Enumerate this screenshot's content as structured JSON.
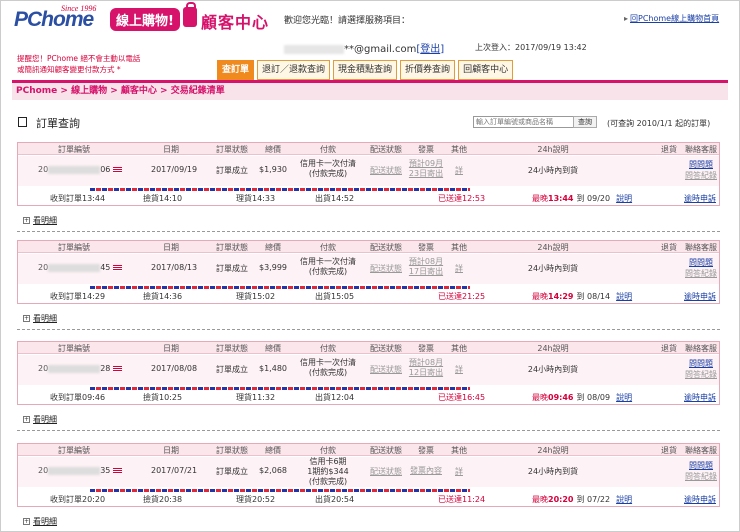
{
  "header": {
    "logo_text": "PChome",
    "logo_since": "Since 1996",
    "logo_shop": "線上購物!",
    "section_title": "顧客中心",
    "welcome": "歡迎您光臨！請選擇服務項目：",
    "back_link": "回PChome線上購物首頁",
    "email_suffix": "**@gmail.com",
    "logout_open": "[",
    "logout": "登出",
    "logout_close": "]",
    "last_login": "上次登入：2017/09/19 13:42",
    "notice_line1": "提醒您！PChome 絕不會主動以電話",
    "notice_line2": "或簡訊通知顧客變更付款方式 *"
  },
  "tabs": [
    {
      "label": "查訂單",
      "active": true
    },
    {
      "label": "退訂／退款查詢",
      "active": false
    },
    {
      "label": "現金積點查詢",
      "active": false
    },
    {
      "label": "折價券查詢",
      "active": false
    },
    {
      "label": "回顧客中心",
      "active": false
    }
  ],
  "breadcrumb": "PChome > 線上購物 > 顧客中心 > 交易紀錄清單",
  "query": {
    "title": "訂單查詢",
    "input_placeholder": "輸入訂單編號或商品名稱",
    "button": "查詢",
    "note": "(可查詢 2010/1/1 起的訂單)"
  },
  "columns": [
    "訂單編號",
    "日期",
    "訂單狀態",
    "總價",
    "付款",
    "配送狀態",
    "發票",
    "其他",
    "24h說明",
    "退貨",
    "聯絡客服"
  ],
  "detail_label": "看明細",
  "orders": [
    {
      "id_visible_prefix": "20",
      "id_visible_suffix": "06",
      "date": "2017/09/19",
      "status": "訂單成立",
      "total": "$1,930",
      "pay1": "信用卡一次付清",
      "pay2": "(付款完成)",
      "shipping": "配送狀態",
      "invoice1": "預計09月",
      "invoice2": "23日寄出",
      "other": "詳",
      "explain": "24小時內到貨",
      "service1": "問問題",
      "service2": "問答紀錄",
      "received": "收到訂單13:44",
      "picked": "撿貨14:10",
      "sorted": "理貨14:33",
      "shipped": "出貨14:52",
      "delivered": "已送達12:53",
      "latest_prefix": "最晚",
      "latest_time": "13:44",
      "latest_suffix": "到 09/20",
      "latest_link": "說明",
      "complaint": "逾時申訴"
    },
    {
      "id_visible_prefix": "20",
      "id_visible_suffix": "45",
      "date": "2017/08/13",
      "status": "訂單成立",
      "total": "$3,999",
      "pay1": "信用卡一次付清",
      "pay2": "(付款完成)",
      "shipping": "配送狀態",
      "invoice1": "預計08月",
      "invoice2": "17日寄出",
      "other": "詳",
      "explain": "24小時內到貨",
      "service1": "問問題",
      "service2": "問答紀錄",
      "received": "收到訂單14:29",
      "picked": "撿貨14:36",
      "sorted": "理貨15:02",
      "shipped": "出貨15:05",
      "delivered": "已送達21:25",
      "latest_prefix": "最晚",
      "latest_time": "14:29",
      "latest_suffix": "到 08/14",
      "latest_link": "說明",
      "complaint": "逾時申訴"
    },
    {
      "id_visible_prefix": "20",
      "id_visible_suffix": "28",
      "date": "2017/08/08",
      "status": "訂單成立",
      "total": "$1,480",
      "pay1": "信用卡一次付清",
      "pay2": "(付款完成)",
      "shipping": "配送狀態",
      "invoice1": "預計08月",
      "invoice2": "12日寄出",
      "other": "詳",
      "explain": "24小時內到貨",
      "service1": "問問題",
      "service2": "問答紀錄",
      "received": "收到訂單09:46",
      "picked": "撿貨10:25",
      "sorted": "理貨11:32",
      "shipped": "出貨12:04",
      "delivered": "已送達16:45",
      "latest_prefix": "最晚",
      "latest_time": "09:46",
      "latest_suffix": "到 08/09",
      "latest_link": "說明",
      "complaint": "逾時申訴"
    },
    {
      "id_visible_prefix": "20",
      "id_visible_suffix": "35",
      "date": "2017/07/21",
      "status": "訂單成立",
      "total": "$2,068",
      "pay1": "信用卡6期",
      "pay1b": "1期約$344",
      "pay2": "(付款完成)",
      "shipping": "配送狀態",
      "invoice1": "發票內容",
      "invoice2": "",
      "other": "詳",
      "explain": "24小時內到貨",
      "service1": "問問題",
      "service2": "問答紀錄",
      "received": "收到訂單20:20",
      "picked": "撿貨20:38",
      "sorted": "理貨20:52",
      "shipped": "出貨20:54",
      "delivered": "已送達11:24",
      "latest_prefix": "最晚",
      "latest_time": "20:20",
      "latest_suffix": "到 07/22",
      "latest_link": "說明",
      "complaint": "逾時申訴"
    }
  ]
}
